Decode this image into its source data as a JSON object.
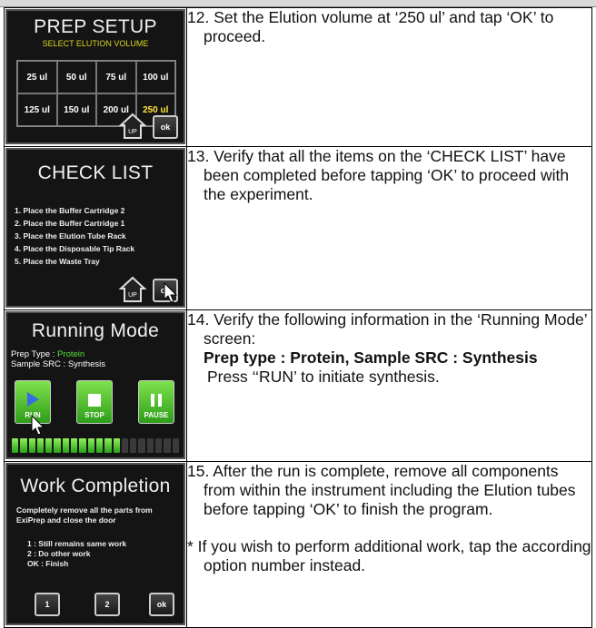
{
  "steps": [
    {
      "screen": {
        "title": "PREP SETUP",
        "subtitle": "SELECT ELUTION VOLUME",
        "volumes": [
          "25 ul",
          "50 ul",
          "75 ul",
          "100 ul",
          "125 ul",
          "150 ul",
          "200 ul",
          "250 ul"
        ],
        "selected_volume": "250 ul",
        "ok_label": "ok"
      },
      "text": "12. Set the Elution volume at ‘250 ul’ and tap ‘OK’ to proceed."
    },
    {
      "screen": {
        "title": "CHECK LIST",
        "items": [
          "1. Place the Buffer Cartridge 2",
          "2. Place the Buffer Cartridge 1",
          "3. Place the Elution Tube Rack",
          "4. Place the Disposable Tip Rack",
          "5. Place the Waste Tray"
        ],
        "ok_label": "ok"
      },
      "text": "13. Verify that all the items on the ‘CHECK LIST’ have been completed before tapping ‘OK’ to proceed with the experiment."
    },
    {
      "screen": {
        "title": "Running Mode",
        "prep_type_label": "Prep Type :",
        "prep_type_value": "Protein",
        "sample_label": "Sample SRC :",
        "sample_value": "Synthesis",
        "buttons": [
          "RUN",
          "STOP",
          "PAUSE"
        ],
        "progress_fraction": 0.65
      },
      "text_intro": "14. Verify the following information in the ‘Running Mode’ screen:",
      "text_bold": "Prep type : Protein,    Sample SRC : Synthesis",
      "text_end": "Press ‘‘RUN’ to initiate synthesis."
    },
    {
      "screen": {
        "title": "Work Completion",
        "message": "Completely remove all the parts from ExiPrep and close the door",
        "options": [
          "1 : Still remains same work",
          "2 : Do other work",
          "OK : Finish"
        ],
        "buttons": [
          "1",
          "2",
          "ok"
        ]
      },
      "text": "15. After the run is complete, remove all components from within the instrument including the Elution tubes before tapping ‘OK’ to finish the program.",
      "note": "* If you wish to perform additional work, tap the according option number instead."
    }
  ]
}
